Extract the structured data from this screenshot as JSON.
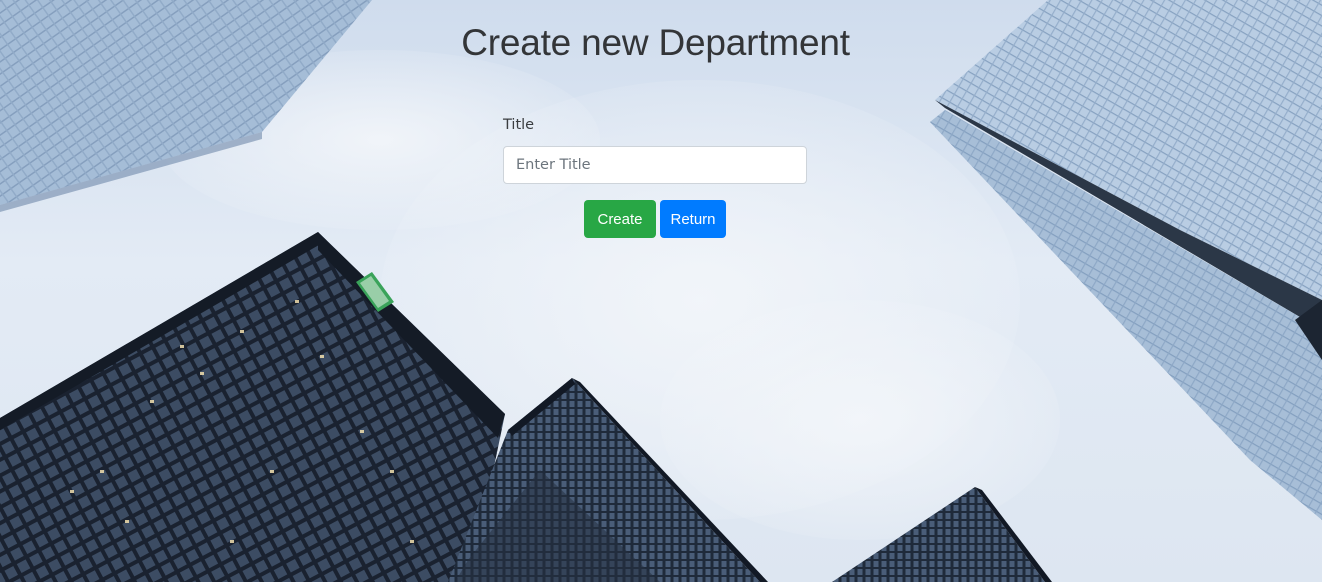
{
  "page": {
    "title": "Create new Department"
  },
  "form": {
    "title_label": "Title",
    "title_input": {
      "value": "",
      "placeholder": "Enter Title"
    },
    "create_label": "Create",
    "return_label": "Return"
  },
  "background": {
    "description_icon": "skyscrapers-background"
  },
  "colors": {
    "create_button": "#28a745",
    "return_button": "#007bff",
    "title_text": "#333538"
  }
}
